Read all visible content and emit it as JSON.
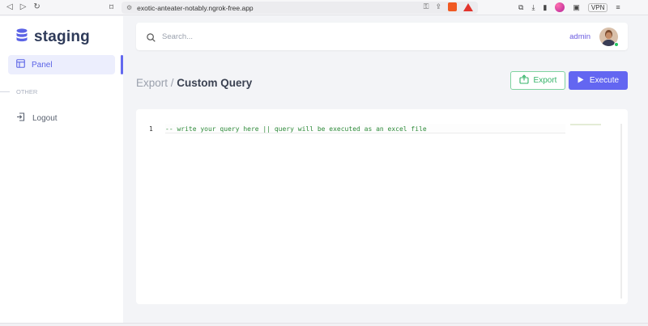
{
  "browser": {
    "url": "exotic-anteater-notably.ngrok-free.app",
    "vpn_label": "VPN"
  },
  "sidebar": {
    "brand": "staging",
    "items": [
      {
        "label": "Panel",
        "icon": "layout-icon",
        "active": true
      }
    ],
    "section_label": "OTHER",
    "other_items": [
      {
        "label": "Logout",
        "icon": "logout-icon"
      }
    ]
  },
  "topbar": {
    "search_placeholder": "Search...",
    "username": "admin"
  },
  "page": {
    "breadcrumb_parent": "Export /",
    "title": "Custom Query",
    "export_label": "Export",
    "execute_label": "Execute"
  },
  "editor": {
    "line_number": "1",
    "code": "-- write your query here || query will be executed as an excel file"
  },
  "colors": {
    "accent": "#6366f1",
    "export_green": "#34b368",
    "code_green": "#2e8b3a"
  }
}
